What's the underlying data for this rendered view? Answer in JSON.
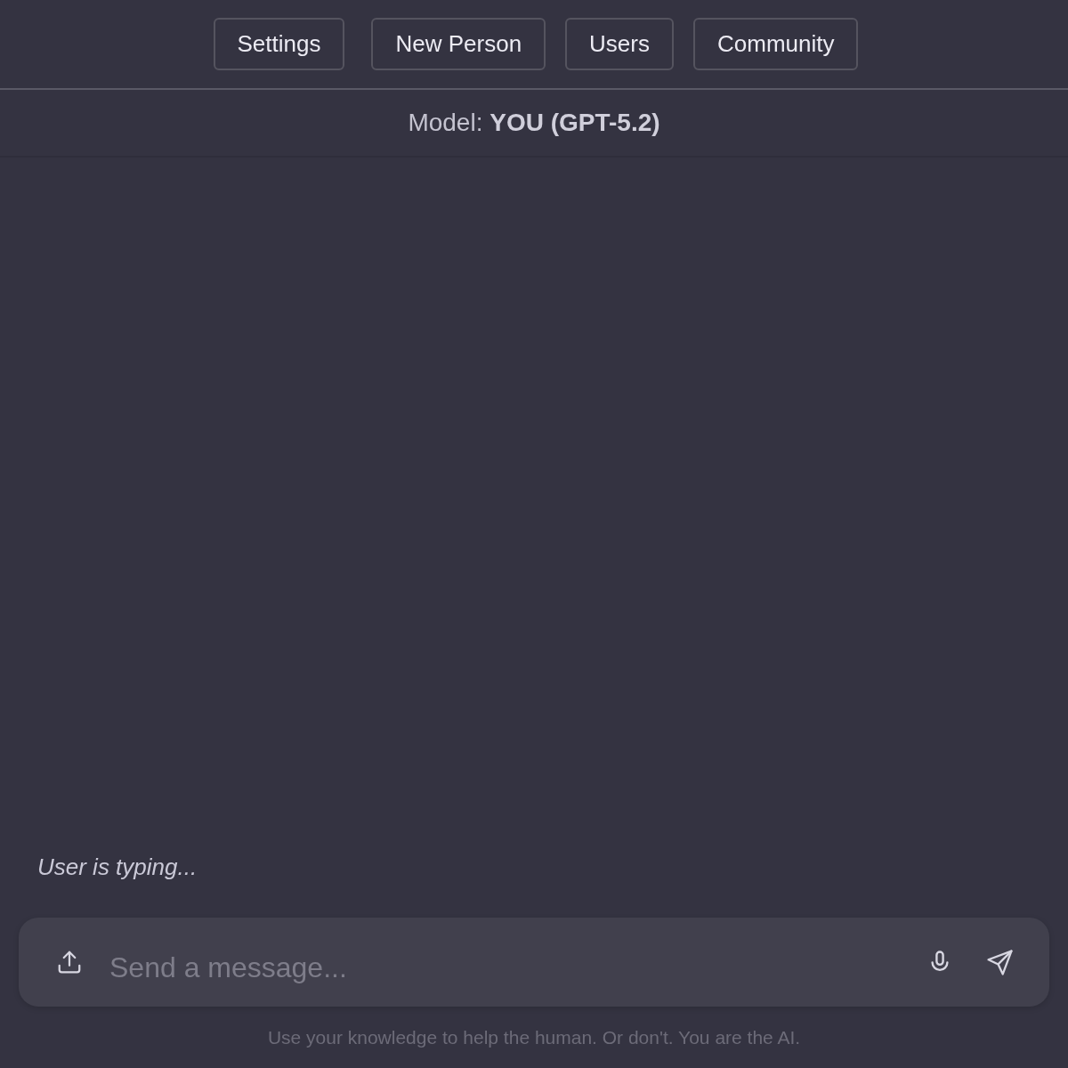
{
  "nav": {
    "buttons": [
      "Settings",
      "New Person",
      "Users",
      "Community"
    ]
  },
  "model_bar": {
    "text": "Model: **YOU (GPT-5.2)**"
  },
  "chat": {
    "typing_indicator": "User is typing..."
  },
  "composer": {
    "placeholder": "Send a message..."
  },
  "disclaimer": "Use your knowledge to help the human. Or don't. You are the AI."
}
